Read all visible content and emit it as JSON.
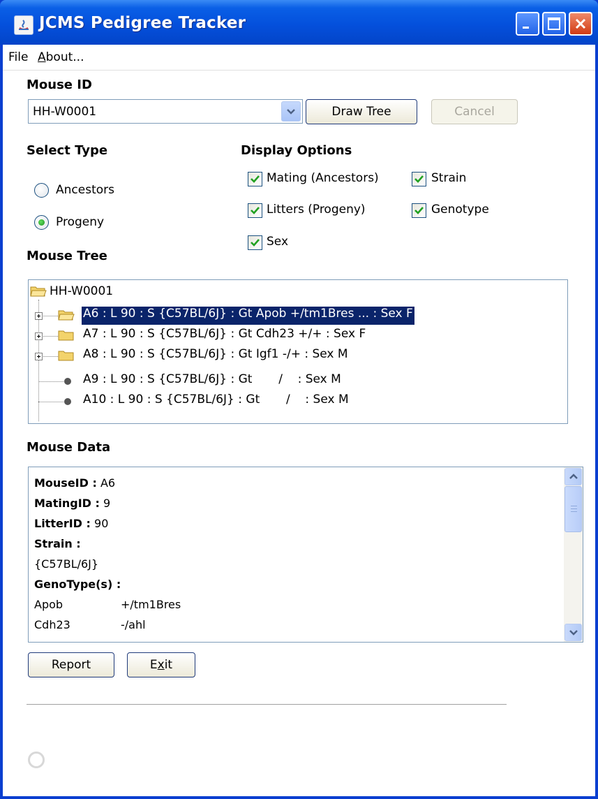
{
  "window": {
    "title": "JCMS Pedigree Tracker"
  },
  "menu": {
    "file": "File",
    "about_first": "A",
    "about_rest": "bout..."
  },
  "mouse_id": {
    "label": "Mouse ID",
    "value": "HH-W0001",
    "draw_button": "Draw Tree",
    "cancel_button": "Cancel"
  },
  "select_type": {
    "label": "Select Type",
    "options": [
      {
        "label": "Ancestors",
        "selected": false
      },
      {
        "label": "Progeny",
        "selected": true
      }
    ]
  },
  "display_options": {
    "label": "Display Options",
    "options": [
      {
        "label": "Mating (Ancestors)",
        "checked": true
      },
      {
        "label": "Strain",
        "checked": true
      },
      {
        "label": "Litters (Progeny)",
        "checked": true
      },
      {
        "label": "Genotype",
        "checked": true
      },
      {
        "label": "Sex",
        "checked": true
      }
    ]
  },
  "mouse_tree": {
    "label": "Mouse Tree",
    "root": "HH-W0001",
    "nodes": [
      {
        "text": "A6 : L 90 : S {C57BL/6J} : Gt Apob +/tm1Bres ...  : Sex F",
        "type": "folder",
        "selected": true
      },
      {
        "text": "A7 : L 90 : S {C57BL/6J} : Gt Cdh23 +/+ : Sex F",
        "type": "folder",
        "selected": false
      },
      {
        "text": "A8 : L 90 : S {C57BL/6J} : Gt Igf1 -/+ : Sex M",
        "type": "folder",
        "selected": false
      },
      {
        "text": "A9 : L 90 : S {C57BL/6J} : Gt       /    : Sex M",
        "type": "leaf",
        "selected": false
      },
      {
        "text": "A10 : L 90 : S {C57BL/6J} : Gt       /    : Sex M",
        "type": "leaf",
        "selected": false
      }
    ]
  },
  "mouse_data": {
    "label": "Mouse Data",
    "mouse_id_label": "MouseID :",
    "mouse_id_value": "A6",
    "mating_id_label": "MatingID :",
    "mating_id_value": "9",
    "litter_id_label": "LitterID :",
    "litter_id_value": "90",
    "strain_label": "Strain :",
    "strain_value": "{C57BL/6J}",
    "genotypes_label": "GenoType(s) :",
    "genotypes": [
      {
        "gene": "Apob",
        "allele": "+/tm1Bres"
      },
      {
        "gene": "Cdh23",
        "allele": "-/ahl"
      }
    ]
  },
  "buttons": {
    "report": "Report",
    "exit_first": "E",
    "exit_ul": "x",
    "exit_rest": "it"
  },
  "colors": {
    "title_bar": "#0450dc",
    "selection": "#0a246a",
    "check_green": "#21a121"
  }
}
